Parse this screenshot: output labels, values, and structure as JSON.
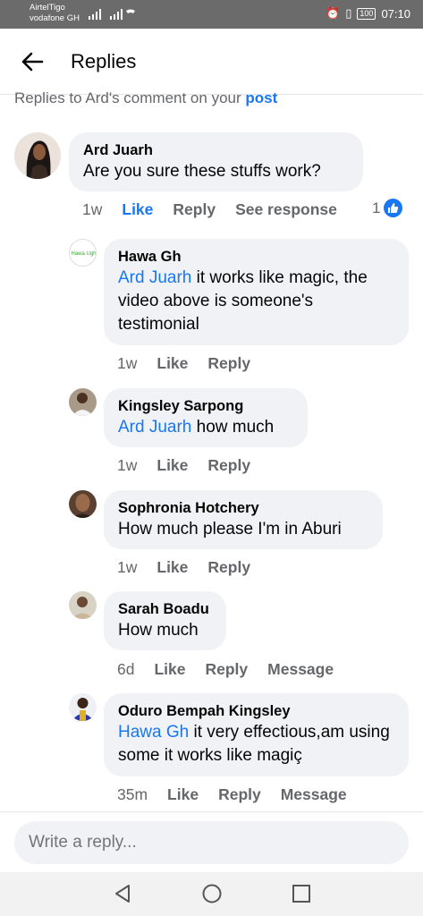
{
  "status_bar": {
    "carrier1": "AirtelTigo",
    "carrier2": "vodafone GH",
    "battery": "100",
    "time": "07:10"
  },
  "header": {
    "title": "Replies",
    "back_icon": "arrow-left-icon"
  },
  "context": {
    "prefix": "Replies to Ard's comment on your ",
    "link": "post"
  },
  "comment": {
    "author": "Ard Juarh",
    "text": "Are you sure these stuffs work?",
    "time": "1w",
    "like_label": "Like",
    "reply_label": "Reply",
    "see_response_label": "See response",
    "reaction_count": "1"
  },
  "replies": [
    {
      "author": "Hawa Gh",
      "mention": "Ard Juarh",
      "text": " it works like magic, the video above is someone's testimonial",
      "time": "1w",
      "like": "Like",
      "reply": "Reply",
      "avatar_text": "Hawa Ugh"
    },
    {
      "author": "Kingsley Sarpong",
      "mention": "Ard Juarh",
      "text": " how much",
      "time": "1w",
      "like": "Like",
      "reply": "Reply"
    },
    {
      "author": "Sophronia Hotchery",
      "mention": "",
      "text": "How much please I'm in Aburi",
      "time": "1w",
      "like": "Like",
      "reply": "Reply"
    },
    {
      "author": "Sarah Boadu",
      "mention": "",
      "text": "How much",
      "time": "6d",
      "like": "Like",
      "reply": "Reply",
      "message": "Message"
    },
    {
      "author": "Oduro Bempah Kingsley",
      "mention": "Hawa Gh",
      "text": "  it very effectious,am using some it works like magiç",
      "time": "35m",
      "like": "Like",
      "reply": "Reply",
      "message": "Message"
    }
  ],
  "reply_box": {
    "placeholder": "Write a reply..."
  },
  "colors": {
    "accent": "#1877f2",
    "bubble": "#f0f2f5",
    "muted": "#65676b"
  }
}
